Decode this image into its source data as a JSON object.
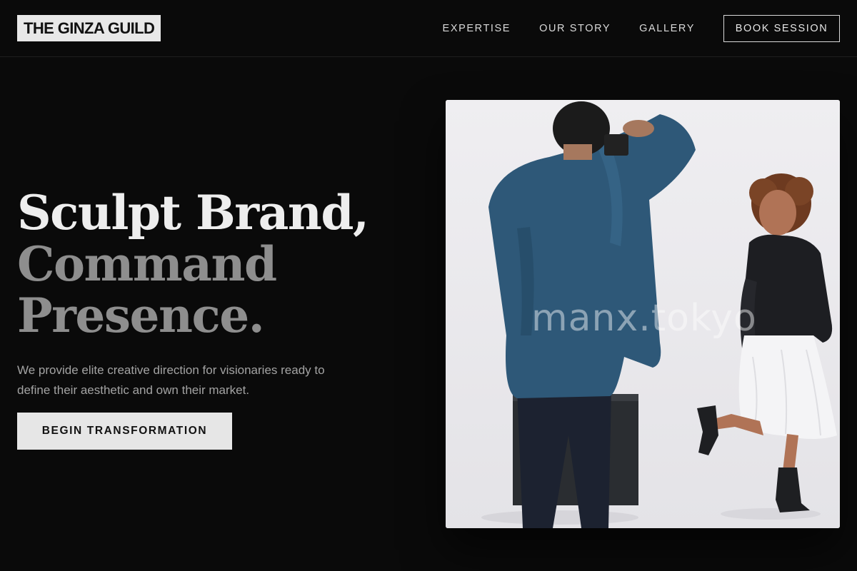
{
  "brand": {
    "logo_text": "THE GINZA GUILD"
  },
  "nav": {
    "items": [
      {
        "label": "EXPERTISE"
      },
      {
        "label": "OUR STORY"
      },
      {
        "label": "GALLERY"
      }
    ],
    "cta_label": "BOOK SESSION"
  },
  "hero": {
    "title_line1": "Sculpt Brand,",
    "title_line2": "Command",
    "title_line3": "Presence.",
    "subtitle": "We provide elite creative direction for visionaries ready to define their aesthetic and own their market.",
    "cta_label": "BEGIN TRANSFORMATION",
    "image_watermark": "manx.tokyo"
  },
  "colors": {
    "background": "#0a0a0a",
    "text_primary": "#eeeeee",
    "text_muted": "#8e8e8e",
    "button_bg": "#e6e6e6"
  }
}
